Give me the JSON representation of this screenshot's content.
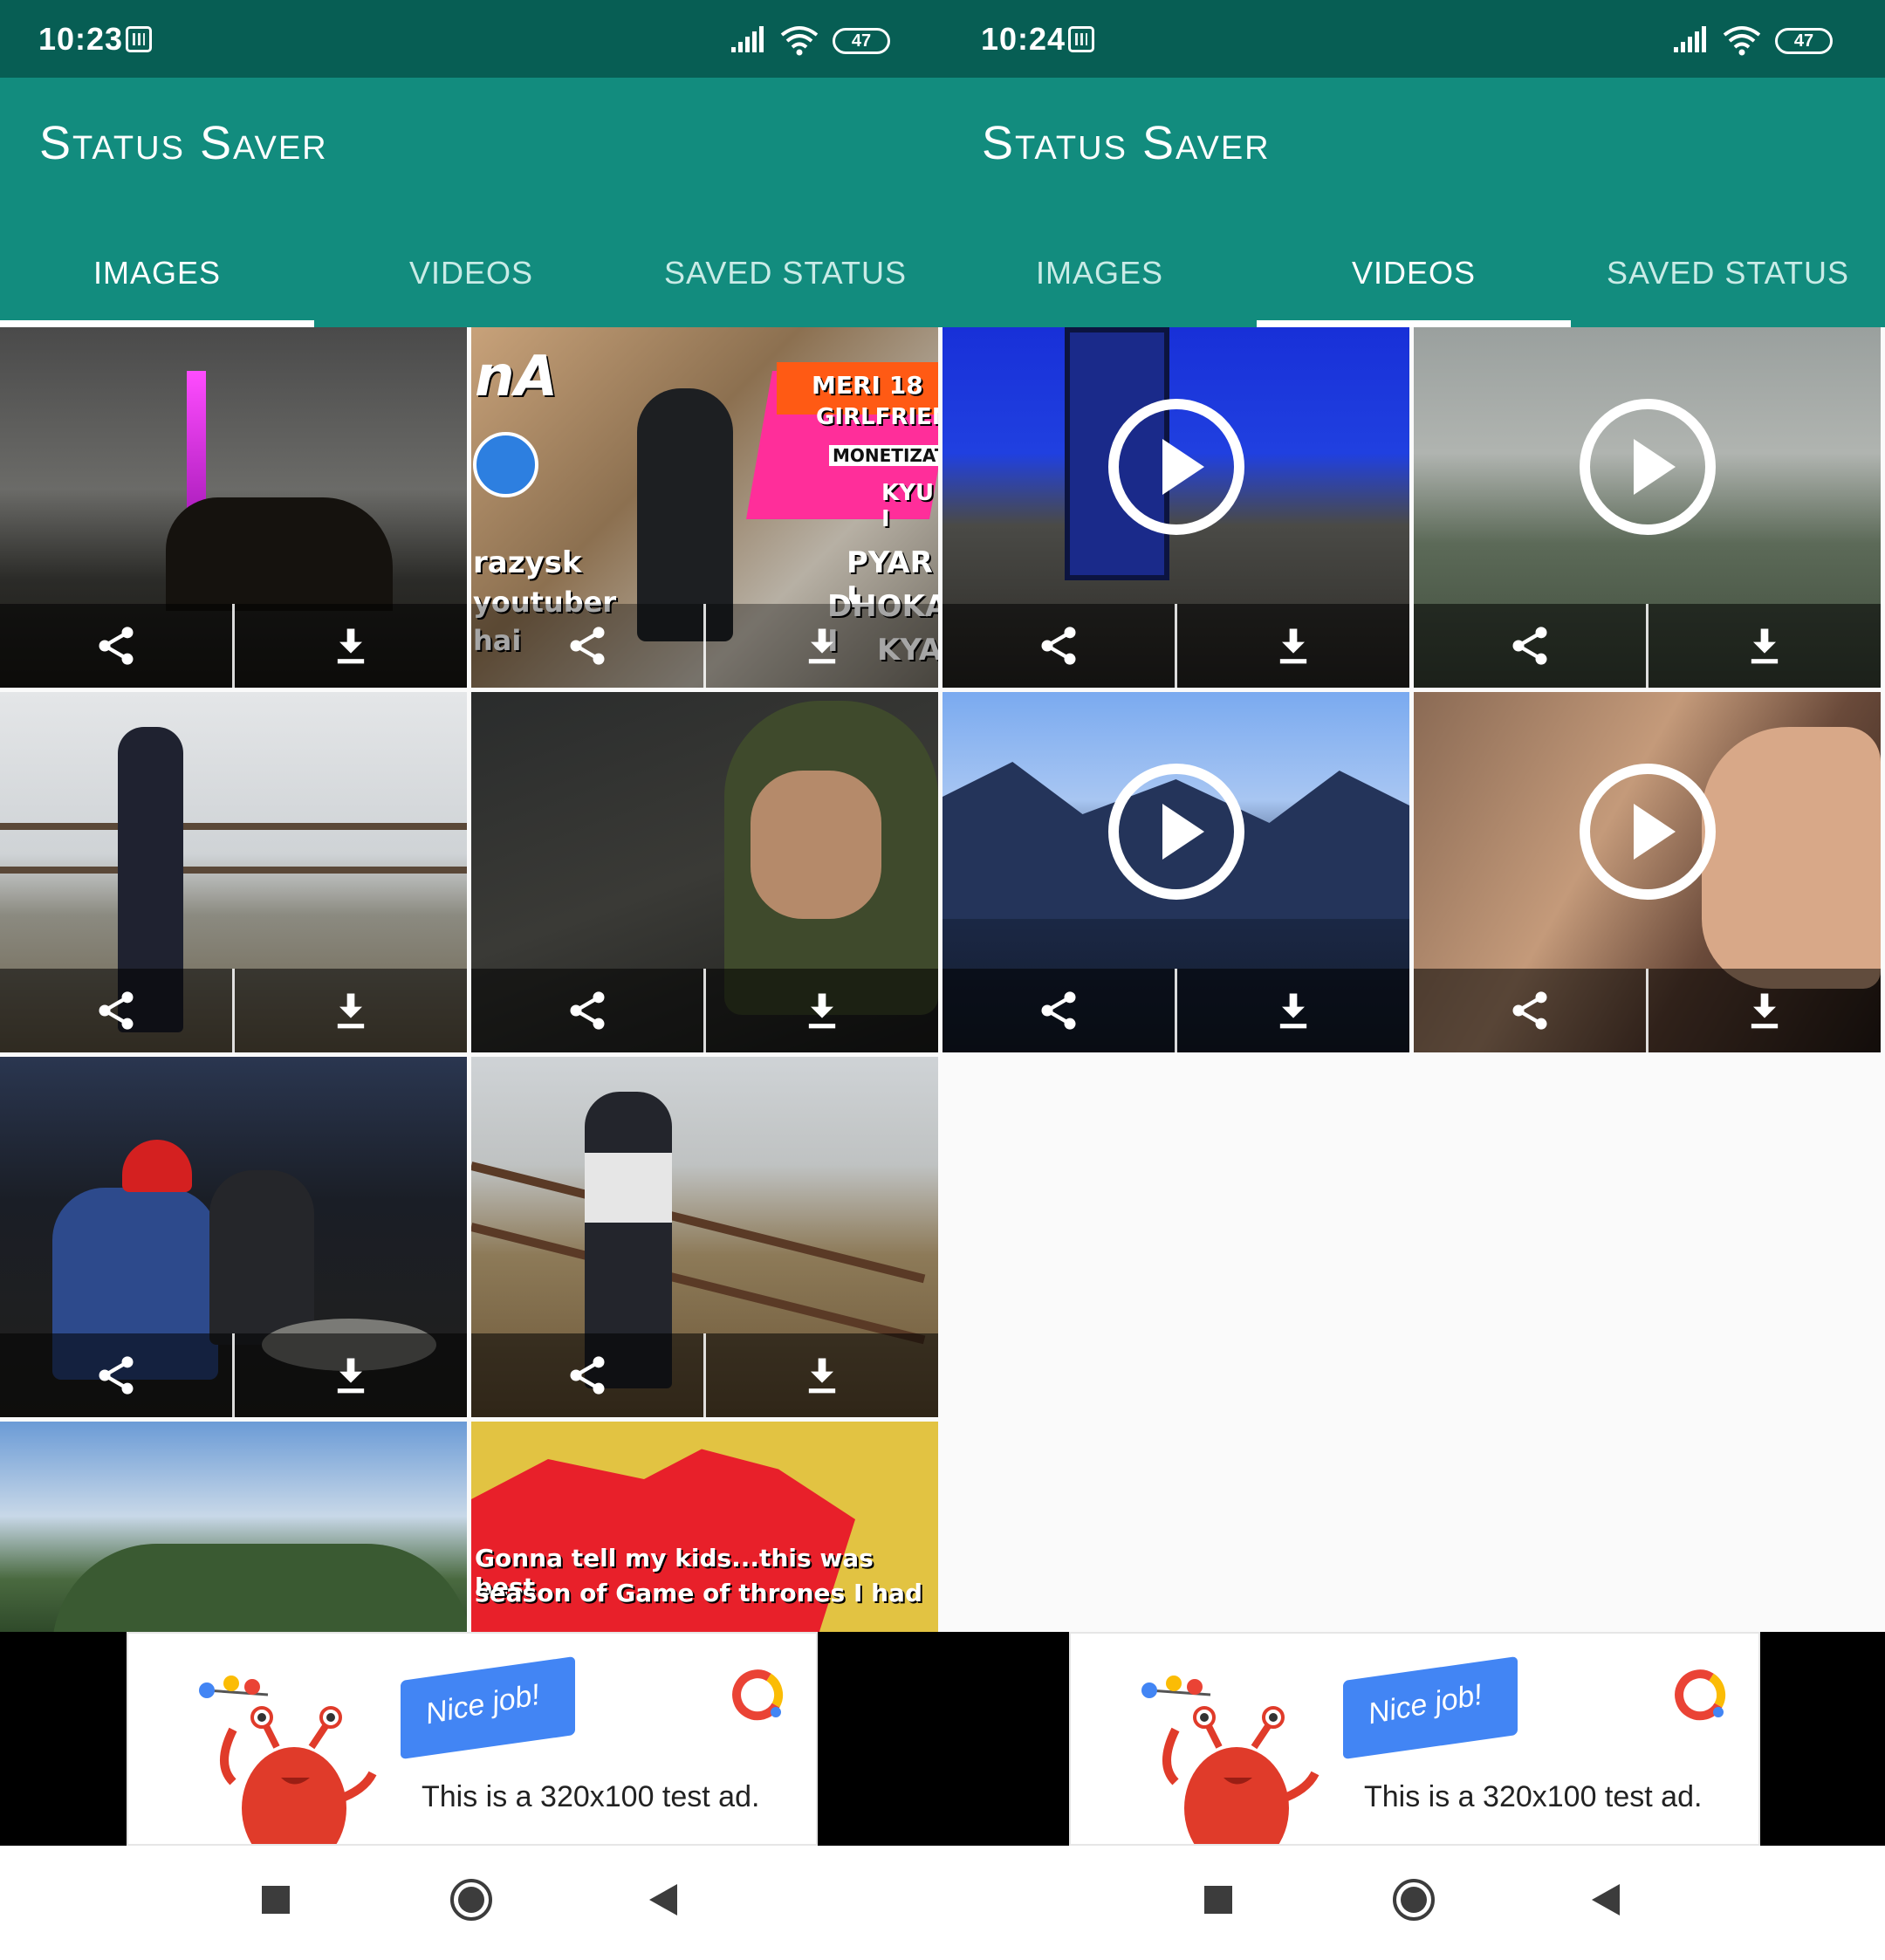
{
  "left": {
    "status_bar": {
      "time": "10:23",
      "battery": "47"
    },
    "app_title": "Status Saver",
    "tabs": [
      {
        "label": "IMAGES",
        "active": true
      },
      {
        "label": "VIDEOS",
        "active": false
      },
      {
        "label": "SAVED STATUS",
        "active": false
      }
    ],
    "thumb2_text": {
      "line1": "nA",
      "line2": "razysk",
      "line3": "youtuber",
      "line4": "hai",
      "tag1": "MERI 18",
      "tag2": "GIRLFRIEN",
      "tag3": "MONETIZATIO",
      "tag4": "KYU I",
      "right1": "PYAR I",
      "right2": "DHOKA I",
      "right3": "KYA?"
    },
    "thumb8_text": {
      "line1": "Gonna tell my kids...this was best",
      "line2": "season of Game of thrones I had"
    }
  },
  "right": {
    "status_bar": {
      "time": "10:24",
      "battery": "47"
    },
    "app_title": "Status Saver",
    "tabs": [
      {
        "label": "IMAGES",
        "active": false
      },
      {
        "label": "VIDEOS",
        "active": true
      },
      {
        "label": "SAVED STATUS",
        "active": false
      }
    ]
  },
  "ad": {
    "banner_label": "Nice job!",
    "text": "This is a 320x100 test ad."
  },
  "icons": {
    "share": "share-icon",
    "download": "download-icon",
    "play": "play-icon"
  },
  "colors": {
    "status_bar": "#075e54",
    "app_bar": "#128c7e"
  }
}
